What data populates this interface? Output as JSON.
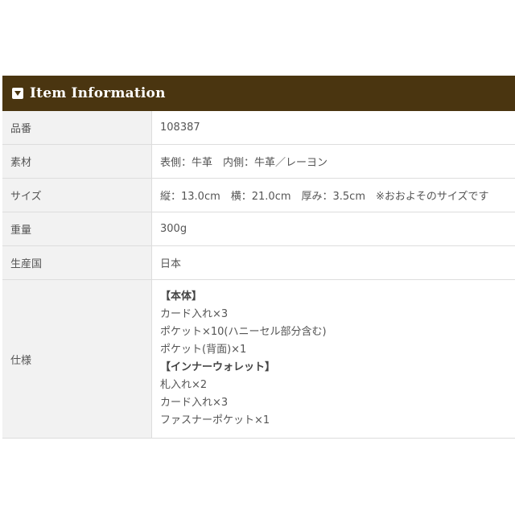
{
  "section": {
    "title": "Item Information",
    "icon": "caret-down-square-icon"
  },
  "rows": [
    {
      "label": "品番",
      "value": "108387"
    },
    {
      "label": "素材",
      "value": "表側：牛革　内側：牛革／レーヨン"
    },
    {
      "label": "サイズ",
      "value": "縦：13.0cm　横：21.0cm　厚み：3.5cm　※おおよそのサイズです"
    },
    {
      "label": "重量",
      "value": "300g"
    },
    {
      "label": "生産国",
      "value": "日本"
    }
  ],
  "spec": {
    "label": "仕様",
    "lines": [
      {
        "text": "【本体】",
        "heading": true
      },
      {
        "text": "カード入れ×3",
        "heading": false
      },
      {
        "text": "ポケット×10(ハニーセル部分含む)",
        "heading": false
      },
      {
        "text": "ポケット(背面)×1",
        "heading": false
      },
      {
        "text": "【インナーウォレット】",
        "heading": true
      },
      {
        "text": "札入れ×2",
        "heading": false
      },
      {
        "text": "カード入れ×3",
        "heading": false
      },
      {
        "text": "ファスナーポケット×1",
        "heading": false
      }
    ]
  }
}
